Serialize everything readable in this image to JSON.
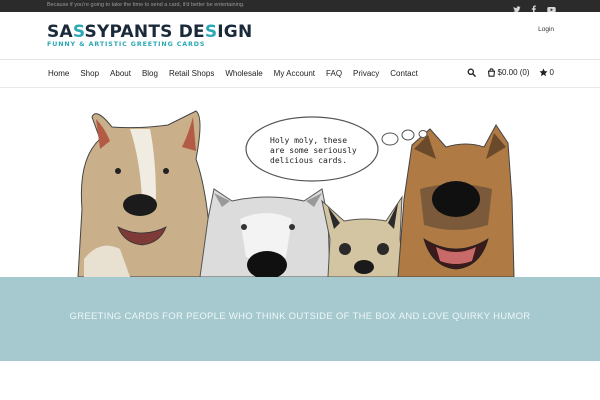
{
  "topbar": {
    "tagline": "Because if you're going to take the time to send a card, it'd better be entertaining.",
    "social": [
      "twitter-icon",
      "facebook-icon",
      "youtube-icon"
    ]
  },
  "header": {
    "logo_name_a": "SA",
    "logo_name_b": "S",
    "logo_name_c": "SYPANTS DE",
    "logo_name_d": "S",
    "logo_name_e": "IGN",
    "logo_sub": "FUNNY & ARTISTIC GREETING CARDS",
    "login_label": "Login"
  },
  "nav": {
    "items": [
      {
        "label": "Home"
      },
      {
        "label": "Shop"
      },
      {
        "label": "About"
      },
      {
        "label": "Blog"
      },
      {
        "label": "Retail Shops"
      },
      {
        "label": "Wholesale"
      },
      {
        "label": "My Account"
      },
      {
        "label": "FAQ"
      },
      {
        "label": "Privacy"
      },
      {
        "label": "Contact"
      }
    ],
    "cart_label": "$0.00 (0)",
    "wishlist_count": "0"
  },
  "hero": {
    "speech_lines": [
      "Holy moly, these",
      "are some seriously",
      "delicious cards."
    ]
  },
  "banner": {
    "text": "GREETING CARDS FOR PEOPLE WHO THINK OUTSIDE OF THE BOX AND LOVE QUIRKY HUMOR"
  },
  "colors": {
    "accent": "#2aa8b4",
    "banner": "#a5c9cf",
    "topbar": "#2b2b2b"
  }
}
